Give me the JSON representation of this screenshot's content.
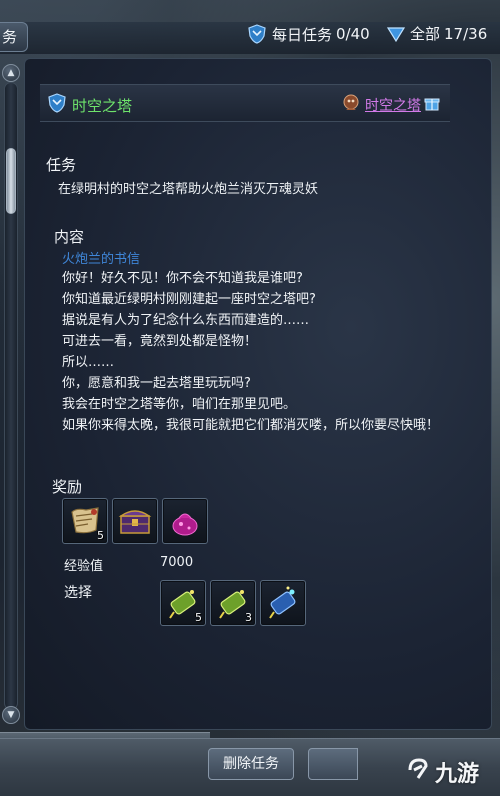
{
  "topbar": {
    "left_tab_text": "务",
    "daily_label": "每日任务",
    "daily_count": "0/40",
    "total_label": "全部",
    "total_count": "17/36"
  },
  "quest": {
    "header_title": "时空之塔",
    "header_link": "时空之塔",
    "task_label": "任务",
    "task_desc": "在绿明村的时空之塔帮助火炮兰消灭万魂灵妖",
    "content_label": "内容",
    "letter_title": "火炮兰的书信",
    "content_lines": [
      "你好！好久不见！你不会不知道我是谁吧?",
      "你知道最近绿明村刚刚建起一座时空之塔吧?",
      "据说是有人为了纪念什么东西而建造的……",
      "可进去一看，竟然到处都是怪物！",
      "所以……",
      "你，愿意和我一起去塔里玩玩吗?",
      "我会在时空之塔等你，咱们在那里见吧。",
      "如果你来得太晚，我很可能就把它们都消灭喽，所以你要尽快哦！"
    ],
    "reward_label": "奖励",
    "reward_items": [
      {
        "icon": "scroll-icon",
        "count": "5"
      },
      {
        "icon": "treasure-chest-icon",
        "count": ""
      },
      {
        "icon": "pink-bag-icon",
        "count": ""
      }
    ],
    "exp_label": "经验值",
    "exp_value": "7000",
    "choice_label": "选择",
    "choice_items": [
      {
        "icon": "green-firework-icon",
        "count": "5"
      },
      {
        "icon": "green-firework-icon",
        "count": "3"
      },
      {
        "icon": "blue-firework-icon",
        "count": ""
      }
    ]
  },
  "bottom": {
    "delete_label": "删除任务",
    "watermark_text": "九游"
  },
  "colors": {
    "header_title": "#6ee36b",
    "header_link": "#d27ae8",
    "letter_title": "#3f86d8"
  }
}
